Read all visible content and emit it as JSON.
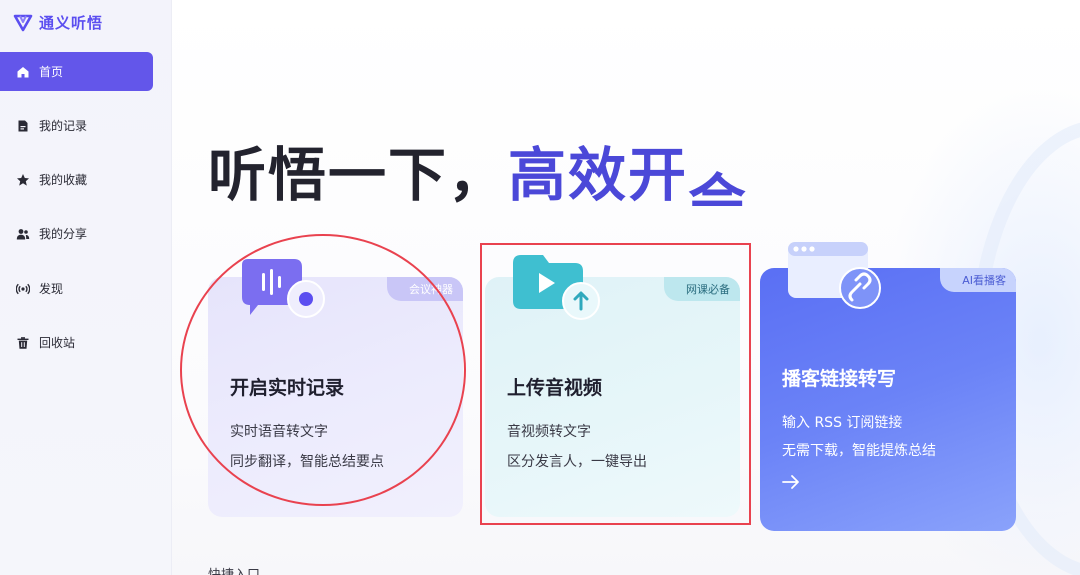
{
  "app": {
    "name": "通义听悟"
  },
  "sidebar": {
    "items": [
      {
        "label": "首页",
        "icon": "home-icon",
        "active": true
      },
      {
        "label": "我的记录",
        "icon": "document-icon",
        "active": false
      },
      {
        "label": "我的收藏",
        "icon": "star-icon",
        "active": false
      },
      {
        "label": "我的分享",
        "icon": "people-icon",
        "active": false
      },
      {
        "label": "发现",
        "icon": "discover-icon",
        "active": false
      },
      {
        "label": "回收站",
        "icon": "trash-icon",
        "active": false
      }
    ]
  },
  "hero": {
    "part1": "听悟一下，",
    "part2": "高效开",
    "part3": "会"
  },
  "cards": [
    {
      "tag": "会议神器",
      "title": "开启实时记录",
      "lines": [
        "实时语音转文字",
        "同步翻译，智能总结要点"
      ],
      "icon": "microphone-record-icon"
    },
    {
      "tag": "网课必备",
      "title": "上传音视频",
      "lines": [
        "音视频转文字",
        "区分发言人，一键导出"
      ],
      "icon": "upload-video-icon"
    },
    {
      "tag": "AI看播客",
      "title": "播客链接转写",
      "lines": [
        "输入 RSS 订阅链接",
        "无需下载，智能提炼总结"
      ],
      "icon": "link-browser-icon"
    }
  ],
  "quick_entry": {
    "label": "快捷入口"
  },
  "colors": {
    "accent": "#6356ea",
    "hero_blue": "#4b48d8",
    "annotation_red": "#e9424f"
  }
}
